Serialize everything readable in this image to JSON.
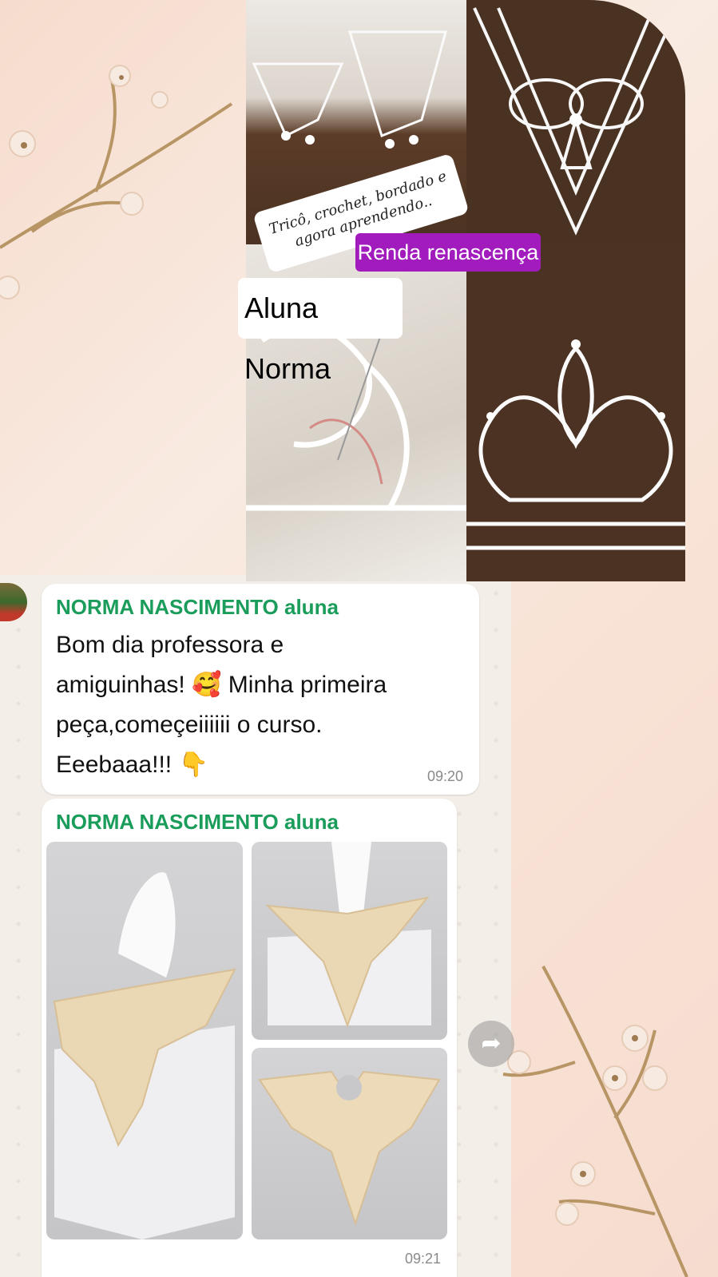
{
  "status_collage": {
    "tag_handwritten_line1": "Tricô, crochet, bordado e",
    "tag_handwritten_line2": "agora aprendendo..",
    "tag_purple": "Renda renascença",
    "tag_name": "Aluna Norma"
  },
  "messages": [
    {
      "sender": "NORMA NASCIMENTO aluna",
      "text": "Bom dia professora e\namiguinhas! 🥰 Minha primeira\npeça,começeiiiiii o curso.\nEeebaaa!!! 👇",
      "time": "09:20"
    },
    {
      "sender": "NORMA NASCIMENTO aluna",
      "time": "09:21"
    }
  ],
  "forward_icon": "forward-arrow-icon",
  "colors": {
    "sender": "#1a9c5a",
    "tag_purple": "#a11bbd",
    "bubble": "#ffffff"
  }
}
